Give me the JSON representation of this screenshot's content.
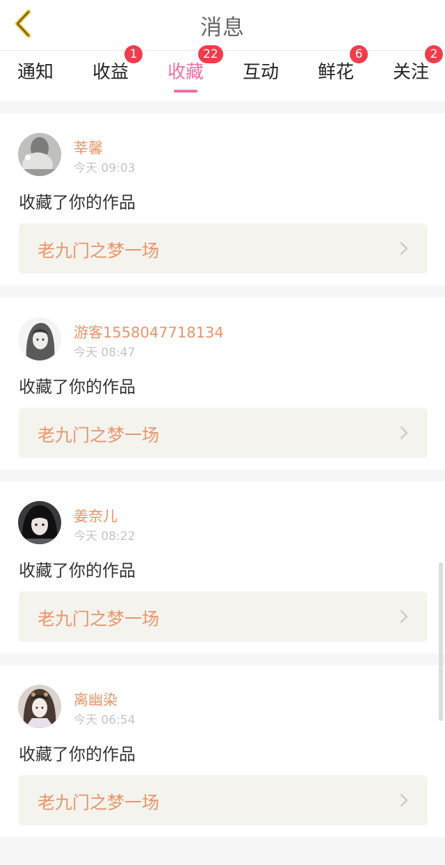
{
  "header": {
    "title": "消息",
    "back_icon": "chevron-left-icon"
  },
  "tabs": [
    {
      "id": "notice",
      "label": "通知",
      "badge": null,
      "active": false
    },
    {
      "id": "income",
      "label": "收益",
      "badge": "1",
      "active": false
    },
    {
      "id": "favorite",
      "label": "收藏",
      "badge": "22",
      "active": true
    },
    {
      "id": "interact",
      "label": "互动",
      "badge": null,
      "active": false
    },
    {
      "id": "flowers",
      "label": "鲜花",
      "badge": "6",
      "active": false
    },
    {
      "id": "follow",
      "label": "关注",
      "badge": "2",
      "active": false
    }
  ],
  "messages": [
    {
      "user": "莘馨",
      "time": "今天 09:03",
      "action": "收藏了你的作品",
      "work": "老九门之梦一场"
    },
    {
      "user": "游客1558047718134",
      "time": "今天 08:47",
      "action": "收藏了你的作品",
      "work": "老九门之梦一场"
    },
    {
      "user": "姜奈儿",
      "time": "今天 08:22",
      "action": "收藏了你的作品",
      "work": "老九门之梦一场"
    },
    {
      "user": "离幽染",
      "time": "今天 06:54",
      "action": "收藏了你的作品",
      "work": "老九门之梦一场"
    }
  ],
  "colors": {
    "accent": "#ee6fa5",
    "badge": "#f23c4c",
    "username": "#e8956a",
    "back_icon": "#e2b424"
  }
}
